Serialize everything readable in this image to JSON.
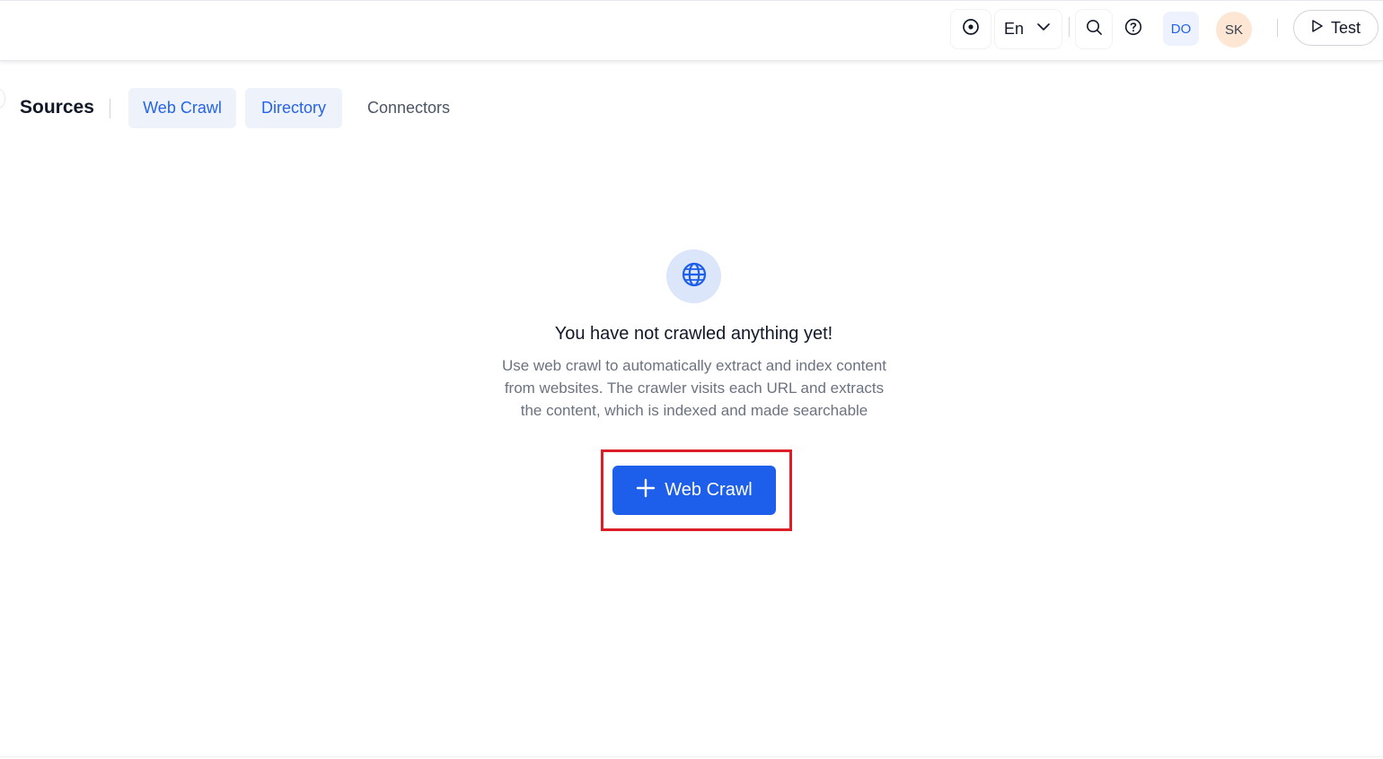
{
  "header": {
    "language": "En",
    "user_initials_primary": "DO",
    "user_initials_secondary": "SK",
    "test_label": "Test",
    "icons": [
      "target-icon",
      "chevron-down-icon",
      "search-icon",
      "help-icon",
      "play-icon"
    ]
  },
  "subnav": {
    "title": "Sources",
    "tabs": [
      {
        "label": "Web Crawl"
      },
      {
        "label": "Directory"
      },
      {
        "label": "Connectors"
      }
    ]
  },
  "empty_state": {
    "icon": "globe-icon",
    "title": "You have not crawled anything yet!",
    "description": "Use web crawl to automatically extract and index content from websites. The crawler visits each URL and extracts the content, which is indexed and made searchable",
    "cta_label": "Web Crawl"
  },
  "colors": {
    "primary": "#1d5eea",
    "highlight": "#dc1f26",
    "tab_bg": "#eef3fb"
  }
}
